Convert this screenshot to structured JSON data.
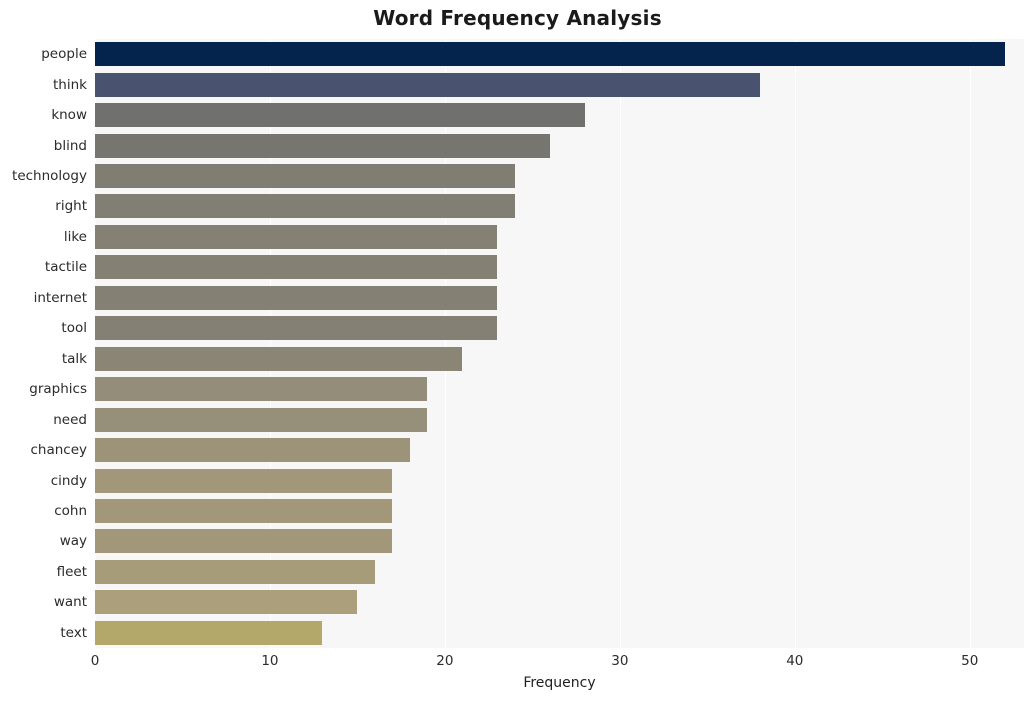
{
  "chart_data": {
    "type": "bar",
    "orientation": "horizontal",
    "title": "Word Frequency Analysis",
    "xlabel": "Frequency",
    "ylabel": "",
    "categories": [
      "people",
      "think",
      "know",
      "blind",
      "technology",
      "right",
      "like",
      "tactile",
      "internet",
      "tool",
      "talk",
      "graphics",
      "need",
      "chancey",
      "cindy",
      "cohn",
      "way",
      "fleet",
      "want",
      "text"
    ],
    "values": [
      52,
      38,
      28,
      26,
      24,
      24,
      23,
      23,
      23,
      23,
      21,
      19,
      19,
      18,
      17,
      17,
      17,
      16,
      15,
      13
    ],
    "xlim": [
      0,
      53.1
    ],
    "xticks": [
      0,
      10,
      20,
      30,
      40,
      50
    ],
    "xtick_labels": [
      "0",
      "10",
      "20",
      "30",
      "40",
      "50"
    ],
    "grid": true,
    "grid_axis": "x",
    "legend": false,
    "bar_colors": [
      "#04234d",
      "#49526e",
      "#70716f",
      "#77756f",
      "#807d73",
      "#817e74",
      "#848074",
      "#848074",
      "#848074",
      "#848074",
      "#8b8576",
      "#948d79",
      "#968f7a",
      "#9c9379",
      "#a29879",
      "#a29879",
      "#a29879",
      "#a79c7a",
      "#ab9f7c",
      "#b4a76a"
    ],
    "plot_background": "#f7f7f7",
    "figure_background": "#ffffff",
    "gridline_color": "#ffffff",
    "text_color": "#2b2b2b"
  }
}
